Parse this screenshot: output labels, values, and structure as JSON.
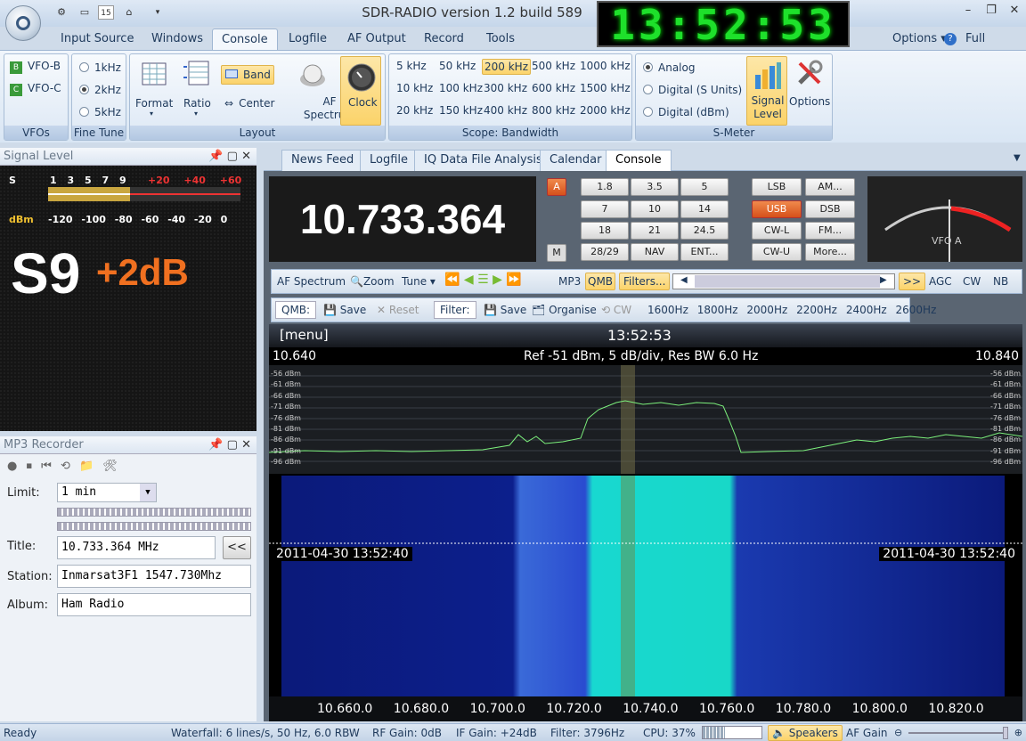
{
  "window": {
    "title": "SDR-RADIO version 1.2  build 589",
    "clock": "13:52:53"
  },
  "menu": {
    "tabs": [
      "Input Source",
      "Windows",
      "Console",
      "Logfile",
      "AF Output",
      "Record",
      "Tools"
    ],
    "active": "Console",
    "options": "Options",
    "full_screen": "Full Screen"
  },
  "ribbon": {
    "vfos": {
      "title": "VFOs",
      "items": [
        "VFO-B",
        "VFO-C"
      ]
    },
    "fine_tune": {
      "title": "Fine Tune",
      "items": [
        "1kHz",
        "2kHz",
        "5kHz"
      ],
      "selected": "2kHz"
    },
    "layout": {
      "title": "Layout",
      "format": "Format",
      "ratio": "Ratio",
      "band": "Band",
      "center": "Center",
      "af_spectrum": "AF Spectrum",
      "clock": "Clock"
    },
    "bandwidth": {
      "title": "Scope: Bandwidth",
      "items": [
        "5 kHz",
        "50 kHz",
        "200 kHz",
        "500 kHz",
        "1000 kHz",
        "10 kHz",
        "100 kHz",
        "300 kHz",
        "600 kHz",
        "1500 kHz",
        "20 kHz",
        "150 kHz",
        "400 kHz",
        "800 kHz",
        "2000 kHz"
      ],
      "selected": "200 kHz"
    },
    "smeter": {
      "title": "S-Meter",
      "items": [
        "Analog",
        "Digital (S Units)",
        "Digital (dBm)"
      ],
      "selected": "Analog",
      "signal_level": "Signal Level",
      "options": "Options"
    }
  },
  "signal_panel": {
    "title": "Signal Level",
    "s_scale": [
      "S",
      "1",
      "3",
      "5",
      "7",
      "9",
      "+20",
      "+40",
      "+60"
    ],
    "dbm_label": "dBm",
    "dbm_scale": [
      "-120",
      "-100",
      "-80",
      "-60",
      "-40",
      "-20",
      "0"
    ],
    "s_value": "S9",
    "s_over": "+2dB"
  },
  "mp3_panel": {
    "title": "MP3 Recorder",
    "limit_label": "Limit:",
    "limit_value": "1 min",
    "title_label": "Title:",
    "title_value": "10.733.364 MHz",
    "station_label": "Station:",
    "station_value": "Inmarsat3F1 1547.730Mhz",
    "album_label": "Album:",
    "album_value": "Ham Radio",
    "back_btn": "<<"
  },
  "doc_tabs": [
    "News Feed",
    "Logfile",
    "IQ Data File Analysis",
    "Calendar",
    "Console"
  ],
  "console": {
    "frequency": "10.733.364",
    "a_label": "A",
    "m_label": "M",
    "keypad": [
      "1.8",
      "3.5",
      "5",
      "7",
      "10",
      "14",
      "18",
      "21",
      "24.5",
      "28/29",
      "NAV",
      "ENT..."
    ],
    "modes": [
      "LSB",
      "AM...",
      "USB",
      "DSB",
      "CW-L",
      "FM...",
      "CW-U",
      "More..."
    ],
    "active_mode": "USB",
    "smeter_label": "VFO A",
    "toolbar1": [
      "AF Spectrum",
      "Zoom",
      "Tune",
      "MP3",
      "QMB",
      "Filters...",
      ">>",
      "AGC",
      "CW",
      "NB"
    ],
    "toolbar2": {
      "qmb": "QMB:",
      "save": "Save",
      "reset": "Reset",
      "filter": "Filter:",
      "save2": "Save",
      "organise": "Organise",
      "cw": "CW",
      "filters": [
        "1600Hz",
        "1800Hz",
        "2000Hz",
        "2200Hz",
        "2400Hz",
        "2600Hz"
      ]
    }
  },
  "scope": {
    "menu": "[menu]",
    "time": "13:52:53",
    "left_freq": "10.640",
    "right_freq": "10.840",
    "ref": "Ref -51 dBm,  5 dB/div,  Res BW 6.0 Hz",
    "db_ticks": [
      "-56 dBm",
      "-61 dBm",
      "-66 dBm",
      "-71 dBm",
      "-76 dBm",
      "-81 dBm",
      "-86 dBm",
      "-91 dBm",
      "-96 dBm"
    ],
    "stamp": "2011-04-30  13:52:40",
    "freq_axis": [
      "10.660.0",
      "10.680.0",
      "10.700.0",
      "10.720.0",
      "10.740.0",
      "10.760.0",
      "10.780.0",
      "10.800.0",
      "10.820.0"
    ]
  },
  "status": {
    "ready": "Ready",
    "waterfall": "Waterfall: 6 lines/s, 50 Hz, 6.0 RBW",
    "rf": "RF Gain: 0dB",
    "if": "IF Gain: +24dB",
    "filter": "Filter: 3796Hz",
    "cpu": "CPU: 37%",
    "speakers": "Speakers",
    "af_gain": "AF Gain"
  }
}
